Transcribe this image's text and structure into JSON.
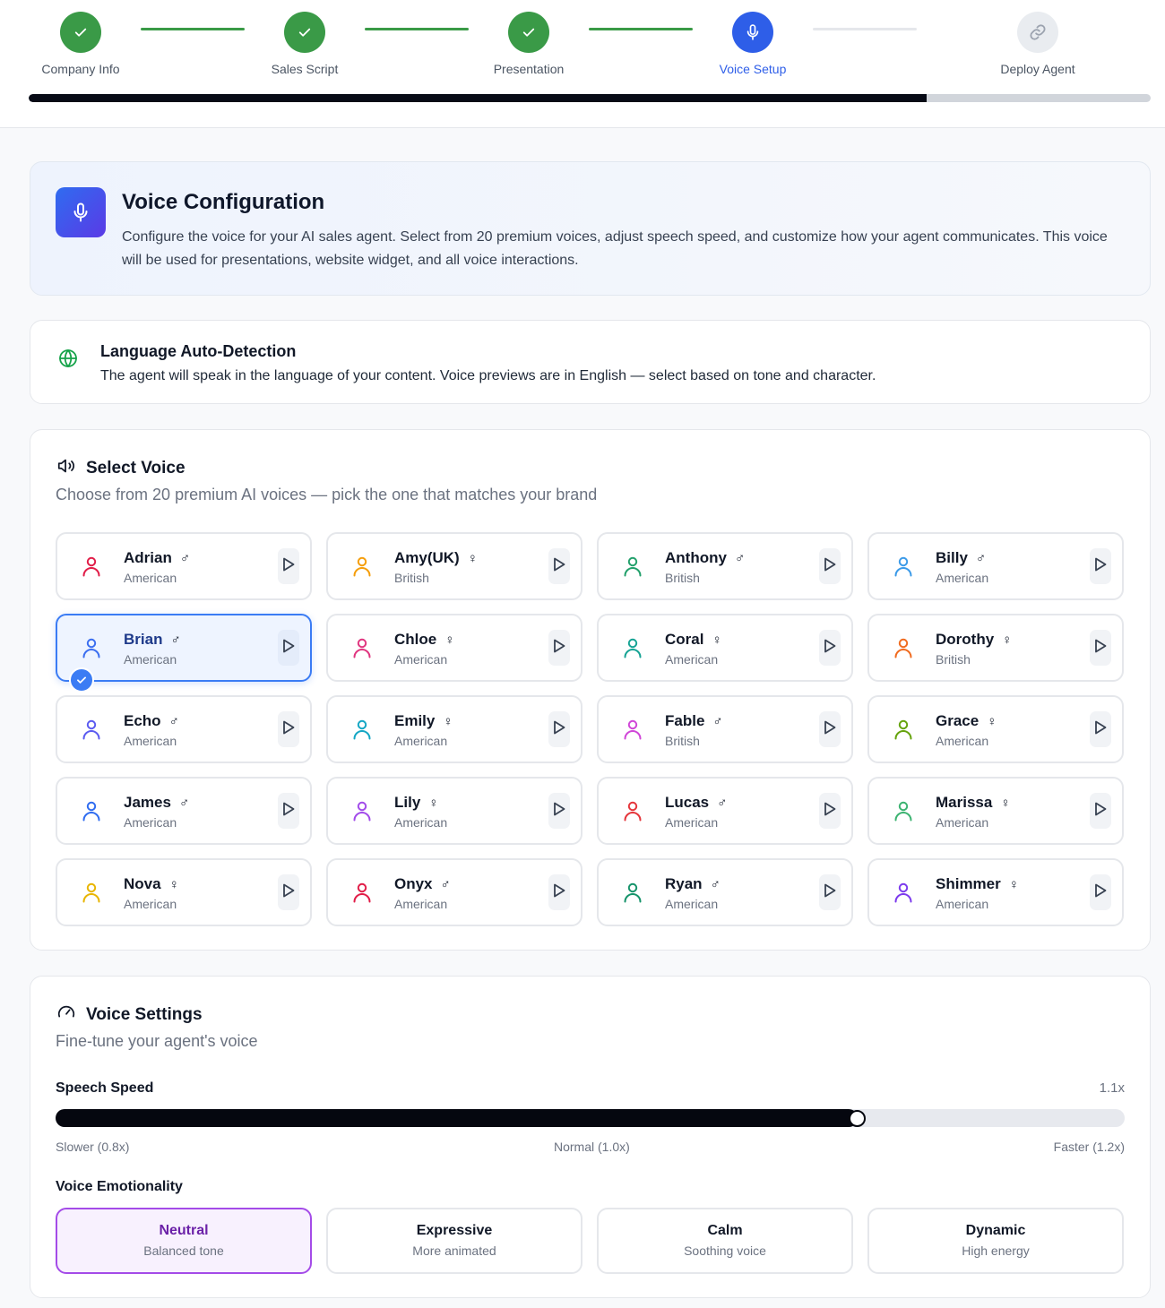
{
  "stepper": {
    "steps": [
      {
        "label": "Company Info",
        "state": "done"
      },
      {
        "label": "Sales Script",
        "state": "done"
      },
      {
        "label": "Presentation",
        "state": "done"
      },
      {
        "label": "Voice Setup",
        "state": "active"
      },
      {
        "label": "Deploy Agent",
        "state": "todo"
      }
    ],
    "progress": 0.8,
    "colors": {
      "done": "#3a9a47",
      "active": "#2e5ee8",
      "todo": "#e9ecf0"
    }
  },
  "hero": {
    "icon": "microphone-icon",
    "title": "Voice Configuration",
    "description": "Configure the voice for your AI sales agent. Select from 20 premium voices, adjust speech speed, and customize how your agent communicates. This voice will be used for presentations, website widget, and all voice interactions."
  },
  "language": {
    "icon": "globe-icon",
    "title": "Language Auto-Detection",
    "description": "The agent will speak in the language of your content. Voice previews are in English — select based on tone and character."
  },
  "voices": {
    "icon": "speaker-icon",
    "title": "Select Voice",
    "subtitle": "Choose from 20 premium AI voices — pick the one that matches your brand",
    "items": [
      {
        "name": "Adrian",
        "gender": "♂",
        "accent": "American",
        "color": "#e11d48"
      },
      {
        "name": "Amy(UK)",
        "gender": "♀",
        "accent": "British",
        "color": "#f59e0b"
      },
      {
        "name": "Anthony",
        "gender": "♂",
        "accent": "British",
        "color": "#22a06b"
      },
      {
        "name": "Billy",
        "gender": "♂",
        "accent": "American",
        "color": "#3b9ae8"
      },
      {
        "name": "Brian",
        "gender": "♂",
        "accent": "American",
        "color": "#3b6ef0",
        "selected": true
      },
      {
        "name": "Chloe",
        "gender": "♀",
        "accent": "American",
        "color": "#e0357f"
      },
      {
        "name": "Coral",
        "gender": "♀",
        "accent": "American",
        "color": "#16a394"
      },
      {
        "name": "Dorothy",
        "gender": "♀",
        "accent": "British",
        "color": "#f06b1f"
      },
      {
        "name": "Echo",
        "gender": "♂",
        "accent": "American",
        "color": "#5b5bf0"
      },
      {
        "name": "Emily",
        "gender": "♀",
        "accent": "American",
        "color": "#14a6c4"
      },
      {
        "name": "Fable",
        "gender": "♂",
        "accent": "British",
        "color": "#d046d8"
      },
      {
        "name": "Grace",
        "gender": "♀",
        "accent": "American",
        "color": "#65a30d"
      },
      {
        "name": "James",
        "gender": "♂",
        "accent": "American",
        "color": "#2f6cf0"
      },
      {
        "name": "Lily",
        "gender": "♀",
        "accent": "American",
        "color": "#a24bea"
      },
      {
        "name": "Lucas",
        "gender": "♂",
        "accent": "American",
        "color": "#e5353b"
      },
      {
        "name": "Marissa",
        "gender": "♀",
        "accent": "American",
        "color": "#3cb371"
      },
      {
        "name": "Nova",
        "gender": "♀",
        "accent": "American",
        "color": "#e8b500"
      },
      {
        "name": "Onyx",
        "gender": "♂",
        "accent": "American",
        "color": "#e11d48"
      },
      {
        "name": "Ryan",
        "gender": "♂",
        "accent": "American",
        "color": "#15936a"
      },
      {
        "name": "Shimmer",
        "gender": "♀",
        "accent": "American",
        "color": "#7c3aed"
      }
    ]
  },
  "settings": {
    "icon": "gauge-icon",
    "title": "Voice Settings",
    "subtitle": "Fine-tune your agent's voice",
    "speed": {
      "label": "Speech Speed",
      "value_label": "1.1x",
      "value": 1.1,
      "min": 0.8,
      "max": 1.2,
      "min_label": "Slower (0.8x)",
      "mid_label": "Normal (1.0x)",
      "max_label": "Faster (1.2x)"
    },
    "emotionality": {
      "label": "Voice Emotionality",
      "options": [
        {
          "name": "Neutral",
          "desc": "Balanced tone",
          "selected": true
        },
        {
          "name": "Expressive",
          "desc": "More animated"
        },
        {
          "name": "Calm",
          "desc": "Soothing voice"
        },
        {
          "name": "Dynamic",
          "desc": "High energy"
        }
      ]
    }
  }
}
